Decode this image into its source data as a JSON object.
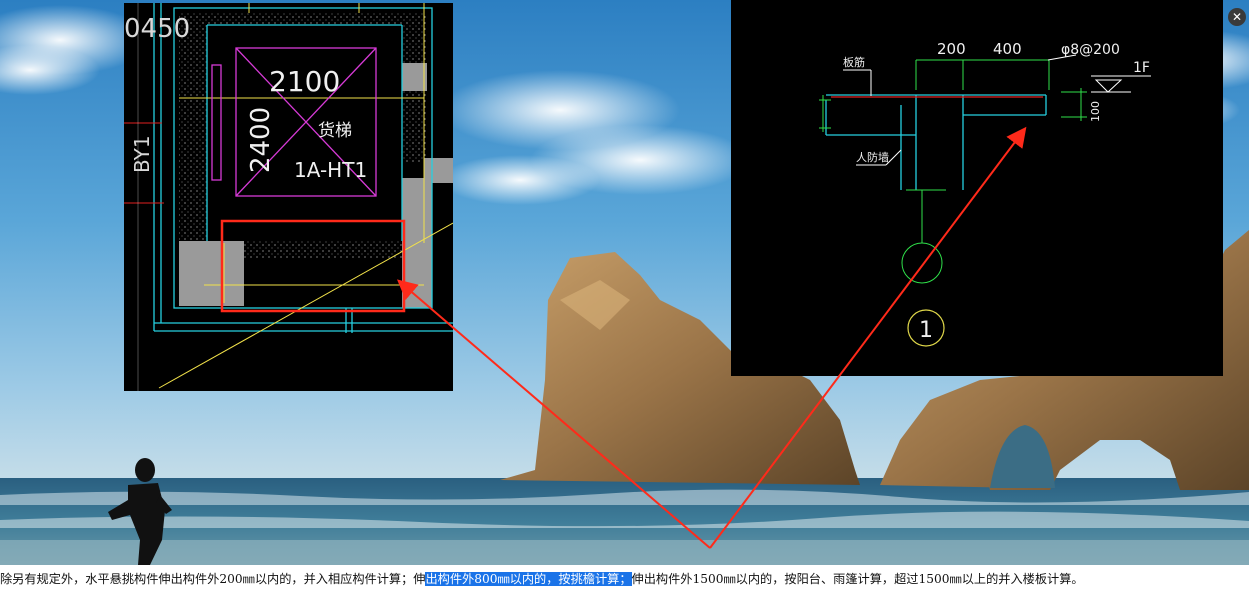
{
  "cad_left": {
    "dim_top": "0450",
    "dim_width": "2100",
    "dim_height": "2400",
    "room_label": "货梯",
    "room_code": "1A-HT1",
    "side_label": "BY1"
  },
  "cad_right": {
    "dim_200": "200",
    "dim_400": "400",
    "rebar": "φ8@200",
    "floor_label": "1F",
    "slab_label": "板筋",
    "wall_label": "人防墙",
    "dim_100": "100",
    "detail_number": "1"
  },
  "close_button": {
    "icon": "close-icon"
  },
  "caption": {
    "before": "除另有规定外，水平悬挑构件伸出构件外200㎜以内的，并入相应构件计算；伸",
    "highlight": "出构件外800㎜以内的，按挑檐计算；",
    "after": "伸出构件外1500㎜以内的，按阳台、雨篷计算，超过1500㎜以上的并入楼板计算。"
  },
  "colors": {
    "highlight": "#1a73e8",
    "arrow": "#ff2a1a",
    "cad_bg": "#000000"
  }
}
